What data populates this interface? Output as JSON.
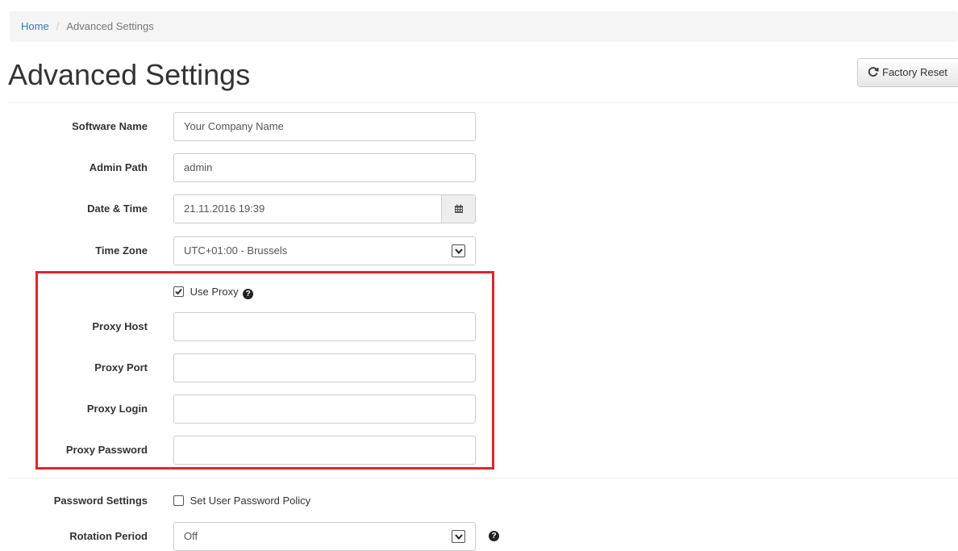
{
  "breadcrumb": {
    "home": "Home",
    "separator": "/",
    "current": "Advanced Settings"
  },
  "page": {
    "title": "Advanced Settings"
  },
  "toolbar": {
    "factory_reset_label": "Factory Reset"
  },
  "form": {
    "software_name": {
      "label": "Software Name",
      "value": "Your Company Name"
    },
    "admin_path": {
      "label": "Admin Path",
      "value": "admin"
    },
    "date_time": {
      "label": "Date & Time",
      "value": "21.11.2016 19:39",
      "icon": "calendar-icon"
    },
    "time_zone": {
      "label": "Time Zone",
      "value": "UTC+01:00 - Brussels"
    },
    "use_proxy": {
      "label": "Use Proxy",
      "checked": true
    },
    "proxy_host": {
      "label": "Proxy Host",
      "value": ""
    },
    "proxy_port": {
      "label": "Proxy Port",
      "value": ""
    },
    "proxy_login": {
      "label": "Proxy Login",
      "value": ""
    },
    "proxy_password": {
      "label": "Proxy Password",
      "value": ""
    },
    "password_settings": {
      "label": "Password Settings",
      "option_label": "Set User Password Policy",
      "checked": false
    },
    "rotation_period": {
      "label": "Rotation Period",
      "value": "Off"
    }
  },
  "colors": {
    "accent": "#337ab7",
    "highlight_border": "#e3242b"
  }
}
